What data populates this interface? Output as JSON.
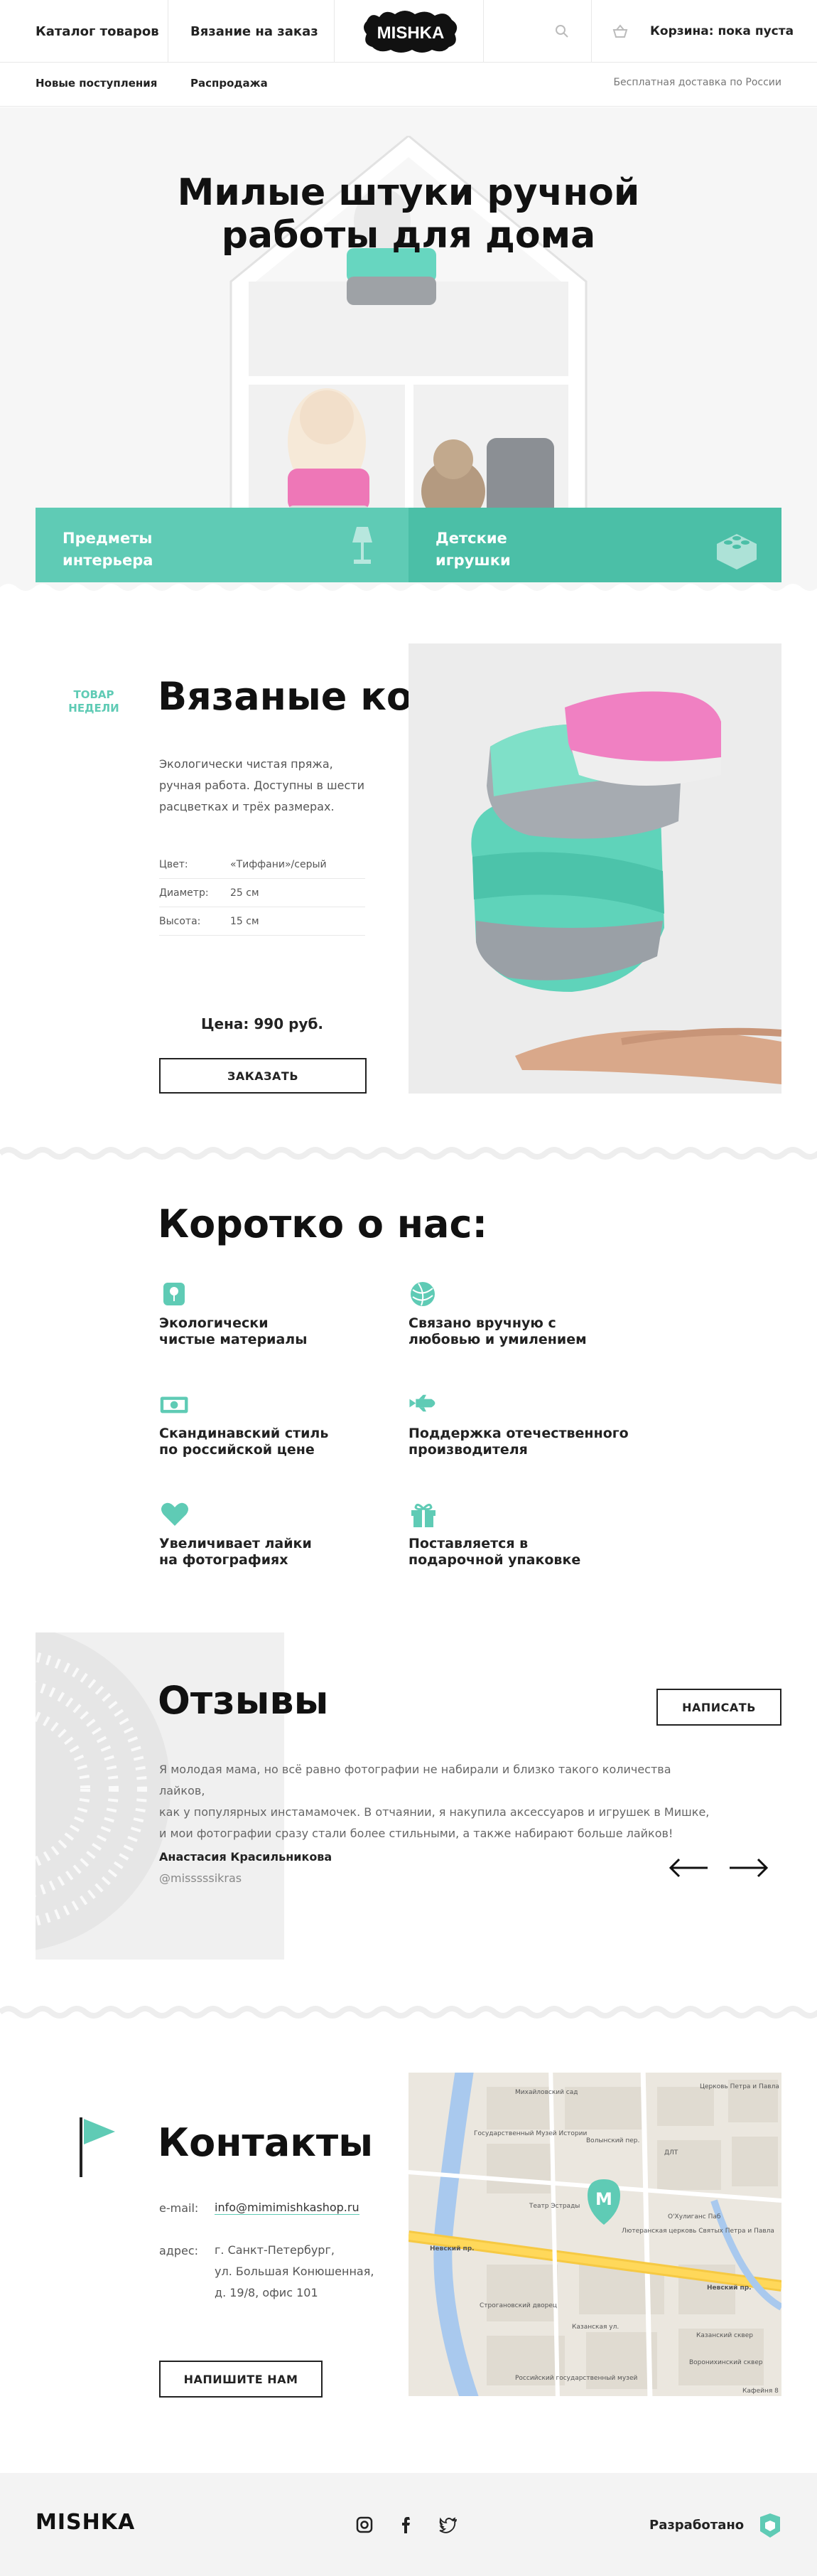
{
  "header": {
    "nav_catalog": "Каталог товаров",
    "nav_custom": "Вязание на заказ",
    "logo_text": "MISHKA",
    "cart_label": "Корзина: пока пуста"
  },
  "subnav": {
    "new_arrivals": "Новые поступления",
    "sale": "Распродажа",
    "shipping": "Бесплатная доставка по России"
  },
  "hero": {
    "title_line1": "Милые штуки ручной",
    "title_line2": "работы для дома",
    "card1_l1": "Предметы",
    "card1_l2": "интерьера",
    "card2_l1": "Детские",
    "card2_l2": "игрушки"
  },
  "product": {
    "badge_l1": "ТОВАР",
    "badge_l2": "НЕДЕЛИ",
    "title": "Вязаные корзинки",
    "desc_l1": "Экологически чистая пряжа,",
    "desc_l2": "ручная работа. Доступны в шести",
    "desc_l3": "расцветках и трёх размерах.",
    "specs": [
      {
        "k": "Цвет:",
        "v": "«Тиффани»/серый"
      },
      {
        "k": "Диаметр:",
        "v": "25 см"
      },
      {
        "k": "Высота:",
        "v": "15 см"
      }
    ],
    "price": "Цена: 990 руб.",
    "order_button": "ЗАКАЗАТЬ"
  },
  "about": {
    "title": "Коротко о нас:",
    "features": [
      {
        "l1": "Экологически",
        "l2": "чистые материалы",
        "icon": "flower-icon"
      },
      {
        "l1": "Связано вручную с",
        "l2": "любовью и умилением",
        "icon": "yarn-ball-icon"
      },
      {
        "l1": "Скандинавский стиль",
        "l2": "по российской цене",
        "icon": "banknote-icon"
      },
      {
        "l1": "Поддержка отечественного",
        "l2": "производителя",
        "icon": "rocket-icon"
      },
      {
        "l1": "Увеличивает лайки",
        "l2": "на фотографиях",
        "icon": "heart-icon"
      },
      {
        "l1": "Поставляется в",
        "l2": "подарочной упаковке",
        "icon": "gift-icon"
      }
    ]
  },
  "reviews": {
    "title": "Отзывы",
    "write_button": "НАПИСАТЬ",
    "text_l1": "Я молодая мама, но всё равно фотографии не набирали и близко такого количества лайков,",
    "text_l2": "как у популярных инстамамочек. В отчаянии, я накупила аксессуаров и игрушек в Мишке,",
    "text_l3": "и мои фотографии сразу стали более стильными, а также набирают больше лайков!",
    "author": "Анастасия Красильникова",
    "handle": "@misssssikras"
  },
  "contacts": {
    "title": "Контакты",
    "email_label": "e-mail:",
    "email": "info@mimimishkashop.ru",
    "address_label": "адрес:",
    "addr_l1": "г. Санкт-Петербург,",
    "addr_l2": "ул. Большая Конюшенная,",
    "addr_l3": "д. 19/8, офис 101",
    "write_button": "НАПИШИТЕ НАМ",
    "map": {
      "marker": "M",
      "labels": [
        "Государственный Музей Истории",
        "Невский пр.",
        "Невский пр.",
        "Строгановский дворец",
        "Российский государственный музей",
        "Казанский сквер",
        "Воронихинский сквер",
        "Михайловский сад",
        "Церковь Петра и Павла",
        "ДЛТ",
        "Волынский пер.",
        "Лютеранская церковь Святых Петра и Павла",
        "О'Хулиганс Паб",
        "Театр Эстрады",
        "Казанская ул.",
        "Кафейня 8"
      ]
    }
  },
  "footer": {
    "logo": "MISHKA",
    "developed": "Разработано"
  },
  "colors": {
    "accent": "#5fcbb5",
    "accent_dark": "#4bbfa7"
  }
}
